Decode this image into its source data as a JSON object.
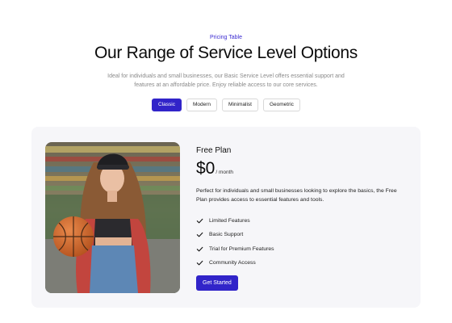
{
  "header": {
    "eyebrow": "Pricing Table",
    "title": "Our Range of Service Level Options",
    "description": "Ideal for individuals and small businesses, our Basic Service Level offers essential support and features at an affordable price. Enjoy reliable access to our core services."
  },
  "tabs": [
    {
      "label": "Classic",
      "active": true
    },
    {
      "label": "Modern",
      "active": false
    },
    {
      "label": "Minimalist",
      "active": false
    },
    {
      "label": "Geometric",
      "active": false
    }
  ],
  "plan": {
    "name": "Free Plan",
    "price": "$0",
    "period": "/ month",
    "description": "Perfect for individuals and small businesses looking to explore the basics, the Free Plan provides access to essential features and tools.",
    "features": [
      "Limited Features",
      "Basic Support",
      "Trial for Premium Features",
      "Community Access"
    ],
    "cta_label": "Get Started"
  },
  "colors": {
    "accent": "#3124c9",
    "card_background": "#f6f6f9"
  },
  "icons": {
    "feature": "check-icon"
  }
}
